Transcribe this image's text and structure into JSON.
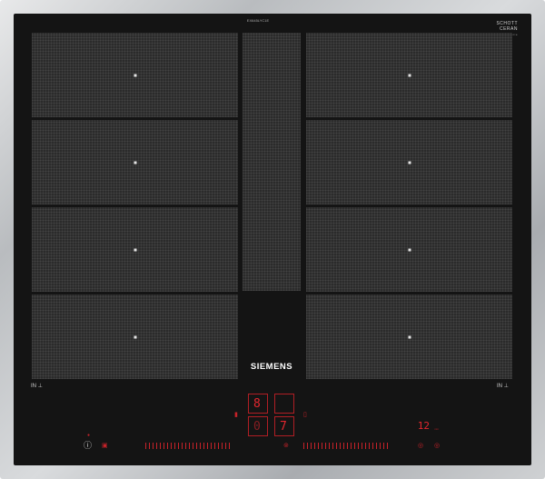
{
  "brand": "SIEMENS",
  "model_number": "EX645LYC1E",
  "glass_maker": {
    "line1": "SCHOTT",
    "line2": "CERAN",
    "line3": "® Serie"
  },
  "zone_labels": {
    "left": "IN",
    "right": "IN"
  },
  "zones_left_count": 4,
  "zones_right_count": 4,
  "display": {
    "upper_digit": "8",
    "lower_left_digit": "0",
    "lower_right_digit": "7",
    "timer_value": "12",
    "timer_unit": "min"
  },
  "icons": {
    "power": "power-icon",
    "lock": "lock-icon",
    "timer_left": "timer-icon",
    "timer_right": "timer-icon"
  },
  "colors": {
    "glass": "#141414",
    "zone": "#2b2b2b",
    "accent": "#d4262c",
    "frame": "#b9bcbf"
  }
}
